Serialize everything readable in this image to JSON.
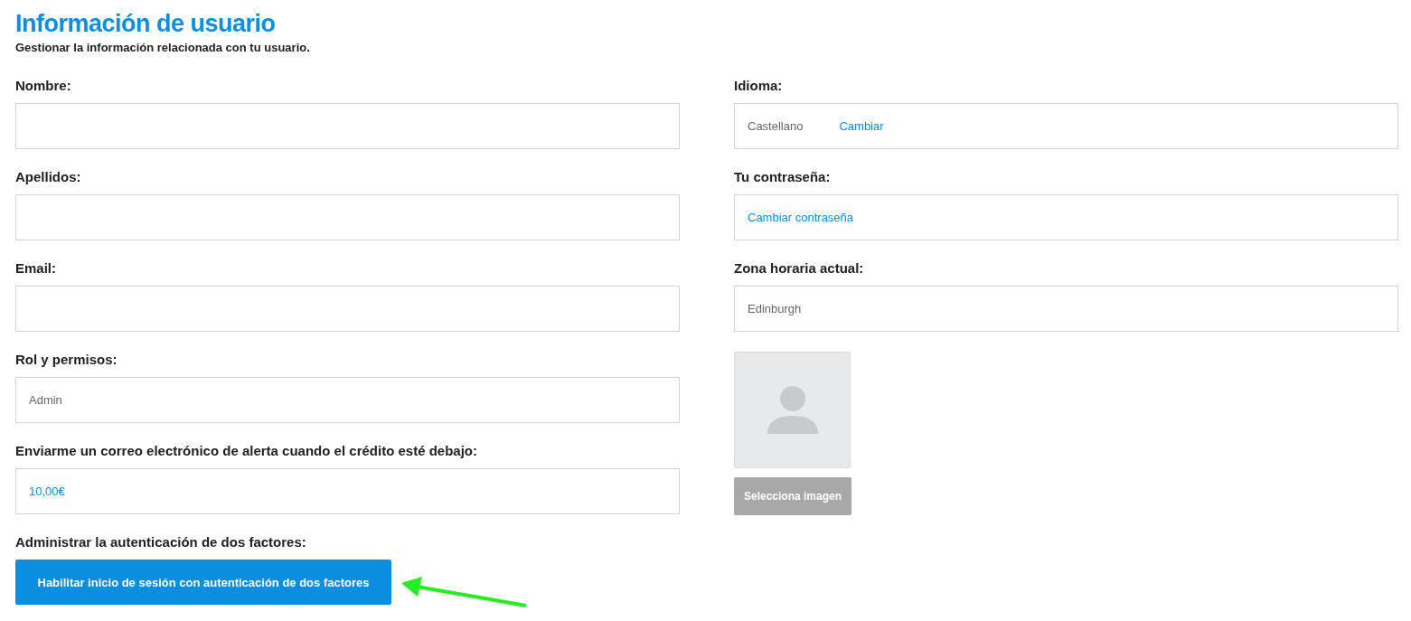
{
  "header": {
    "title": "Información de usuario",
    "subtitle": "Gestionar la información relacionada con tu usuario."
  },
  "left_fields": [
    {
      "label": "Nombre:"
    },
    {
      "label": "Apellidos:"
    },
    {
      "label": "Email:"
    },
    {
      "label": "Rol y permisos:",
      "items": [
        {
          "kind": "text",
          "text": "Admin"
        }
      ]
    },
    {
      "label": "Enviarme un correo electrónico de alerta cuando el crédito esté debajo:",
      "items": [
        {
          "kind": "link",
          "text": "10,00€"
        }
      ]
    }
  ],
  "two_factor": {
    "label": "Administrar la autenticación de dos factores:",
    "button": "Habilitar inicio de sesión con autenticación de dos factores"
  },
  "right_fields": [
    {
      "label": "Idioma:",
      "items": [
        {
          "kind": "text",
          "text": "Castellano"
        },
        {
          "kind": "link",
          "text": "Cambiar"
        }
      ]
    },
    {
      "label": "Tu contraseña:",
      "items": [
        {
          "kind": "link",
          "text": "Cambiar contraseña"
        }
      ]
    },
    {
      "label": "Zona horaria actual:",
      "items": [
        {
          "kind": "text",
          "text": "Edinburgh"
        }
      ]
    }
  ],
  "avatar": {
    "button": "Selecciona imagen"
  }
}
